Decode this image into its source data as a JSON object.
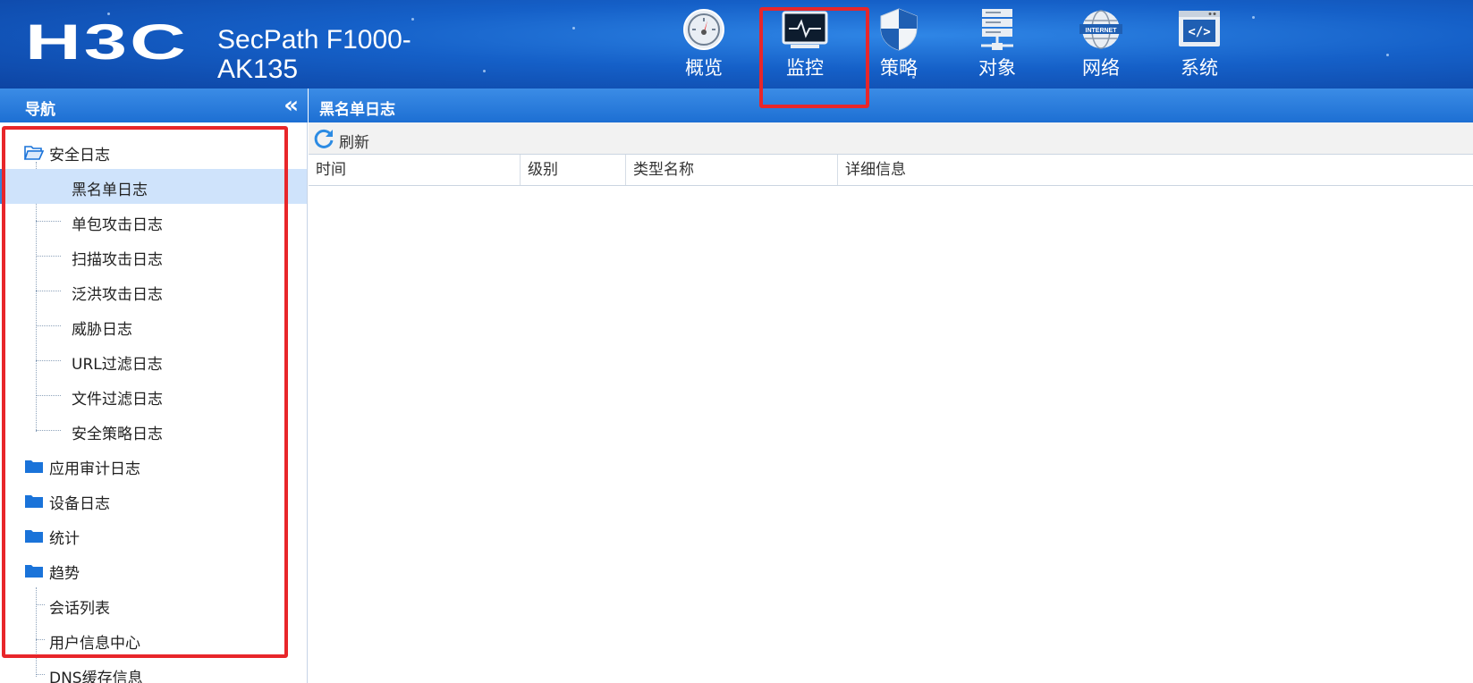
{
  "header": {
    "logo": "H3C",
    "product_line1": "SecPath F1000-",
    "product_line2": "AK135",
    "nav": [
      {
        "label": "概览",
        "icon": "dashboard-icon"
      },
      {
        "label": "监控",
        "icon": "monitor-icon",
        "selected": true
      },
      {
        "label": "策略",
        "icon": "shield-icon"
      },
      {
        "label": "对象",
        "icon": "server-icon"
      },
      {
        "label": "网络",
        "icon": "internet-icon"
      },
      {
        "label": "系统",
        "icon": "code-window-icon"
      }
    ]
  },
  "sidebar": {
    "title": "导航",
    "collapse": "«",
    "items": [
      {
        "label": "安全日志",
        "type": "folder-open"
      },
      {
        "label": "黑名单日志",
        "type": "child",
        "selected": true
      },
      {
        "label": "单包攻击日志",
        "type": "child"
      },
      {
        "label": "扫描攻击日志",
        "type": "child"
      },
      {
        "label": "泛洪攻击日志",
        "type": "child"
      },
      {
        "label": "威胁日志",
        "type": "child"
      },
      {
        "label": "URL过滤日志",
        "type": "child"
      },
      {
        "label": "文件过滤日志",
        "type": "child"
      },
      {
        "label": "安全策略日志",
        "type": "child"
      },
      {
        "label": "应用审计日志",
        "type": "folder"
      },
      {
        "label": "设备日志",
        "type": "folder"
      },
      {
        "label": "统计",
        "type": "folder"
      },
      {
        "label": "趋势",
        "type": "folder"
      },
      {
        "label": "会话列表",
        "type": "leaf"
      },
      {
        "label": "用户信息中心",
        "type": "leaf"
      },
      {
        "label": "DNS缓存信息",
        "type": "leaf"
      }
    ]
  },
  "main": {
    "title": "黑名单日志",
    "refresh_label": "刷新",
    "columns": [
      "时间",
      "级别",
      "类型名称",
      "详细信息"
    ]
  },
  "colors": {
    "header_blue": "#1560c8",
    "bar_blue": "#1d6fd3",
    "highlight_red": "#e8262a",
    "selected_row": "#cfe3fb",
    "folder_blue": "#1a73d9"
  }
}
